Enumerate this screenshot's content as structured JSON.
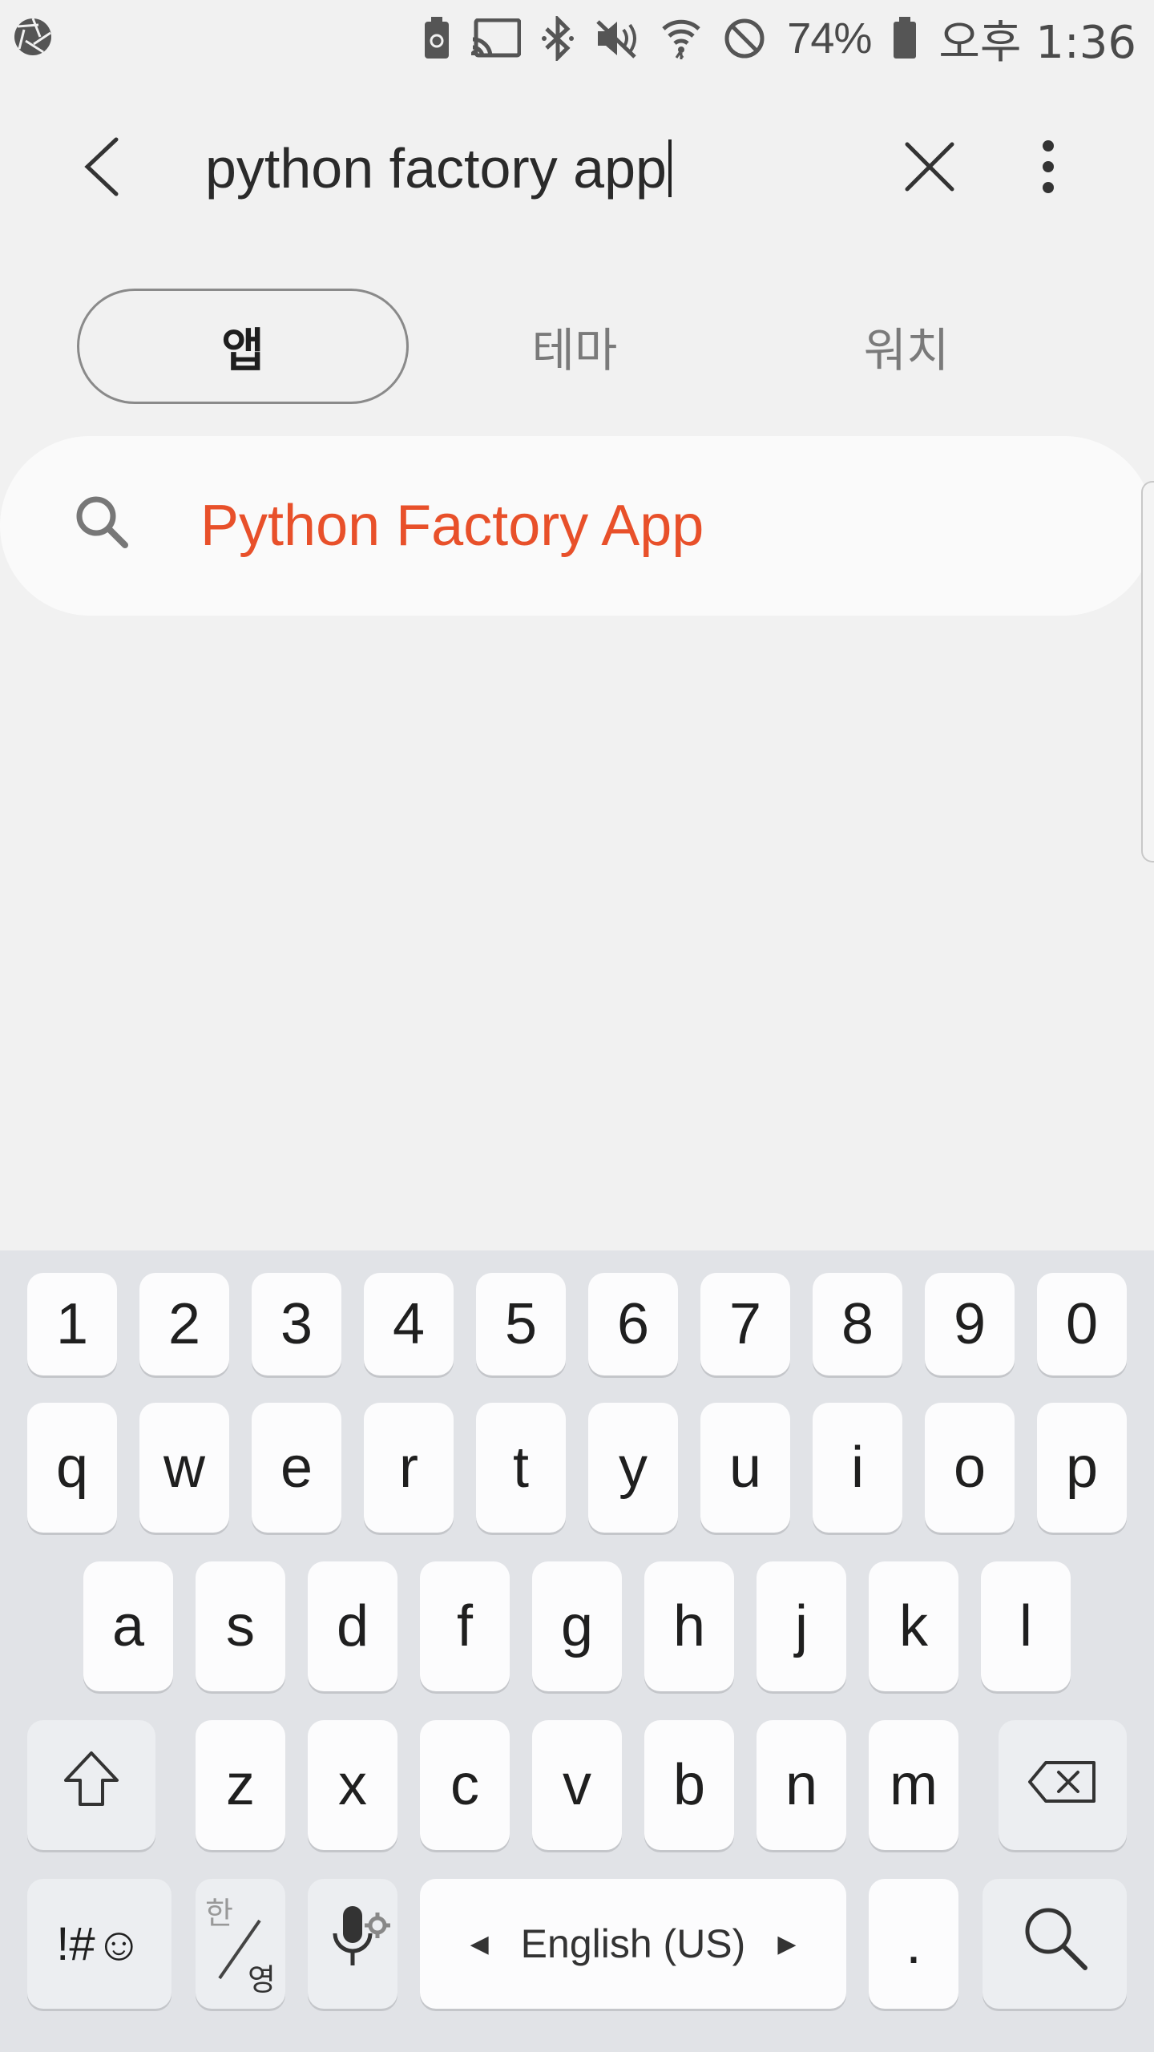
{
  "status_bar": {
    "battery_percent": "74%",
    "ampm": "오후",
    "time": "1:36",
    "icons": [
      "camera-aperture-icon",
      "battery-saver-icon",
      "cast-icon",
      "bluetooth-icon",
      "mute-icon",
      "wifi-icon",
      "do-not-disturb-icon",
      "battery-icon"
    ]
  },
  "search": {
    "query": "python factory app",
    "back_icon": "chevron-left-icon",
    "clear_icon": "close-icon",
    "more_icon": "more-vert-icon"
  },
  "tabs": [
    {
      "label": "앱",
      "selected": true
    },
    {
      "label": "테마",
      "selected": false
    },
    {
      "label": "워치",
      "selected": false
    }
  ],
  "suggestion": {
    "icon": "search-icon",
    "text": "Python Factory App",
    "color": "#e8502a"
  },
  "keyboard": {
    "number_row": [
      "1",
      "2",
      "3",
      "4",
      "5",
      "6",
      "7",
      "8",
      "9",
      "0"
    ],
    "row1": [
      "q",
      "w",
      "e",
      "r",
      "t",
      "y",
      "u",
      "i",
      "o",
      "p"
    ],
    "row2": [
      "a",
      "s",
      "d",
      "f",
      "g",
      "h",
      "j",
      "k",
      "l"
    ],
    "row3": [
      "z",
      "x",
      "c",
      "v",
      "b",
      "n",
      "m"
    ],
    "symbols_label": "!#☺",
    "lang_top": "한",
    "lang_bottom": "영",
    "space_label": "English (US)",
    "period_label": ".",
    "shift_icon": "shift-icon",
    "backspace_icon": "backspace-icon",
    "mic_icon": "microphone-icon",
    "search_icon": "search-icon"
  }
}
